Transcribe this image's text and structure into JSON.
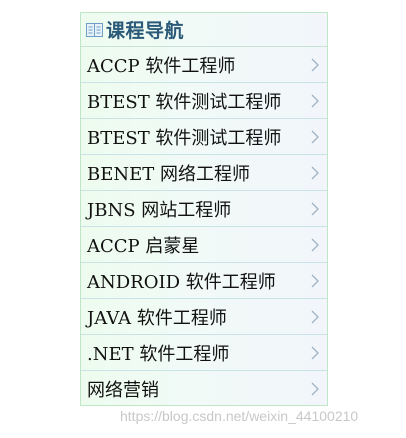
{
  "nav": {
    "title": "课程导航",
    "items": [
      {
        "label": "ACCP 软件工程师"
      },
      {
        "label": "BTEST 软件测试工程师"
      },
      {
        "label": "BTEST 软件测试工程师"
      },
      {
        "label": "BENET 网络工程师"
      },
      {
        "label": "JBNS 网站工程师"
      },
      {
        "label": "ACCP 启蒙星"
      },
      {
        "label": "ANDROID 软件工程师"
      },
      {
        "label": "JAVA 软件工程师"
      },
      {
        "label": ".NET 软件工程师"
      },
      {
        "label": "网络营销"
      }
    ]
  },
  "watermark": "https://blog.csdn.net/weixin_44100210",
  "colors": {
    "title": "#2b5a78",
    "border": "#bfe6c6",
    "chevron": "#9fb3c4"
  },
  "icons": {
    "header": "book-icon",
    "item": "chevron-right-icon"
  }
}
